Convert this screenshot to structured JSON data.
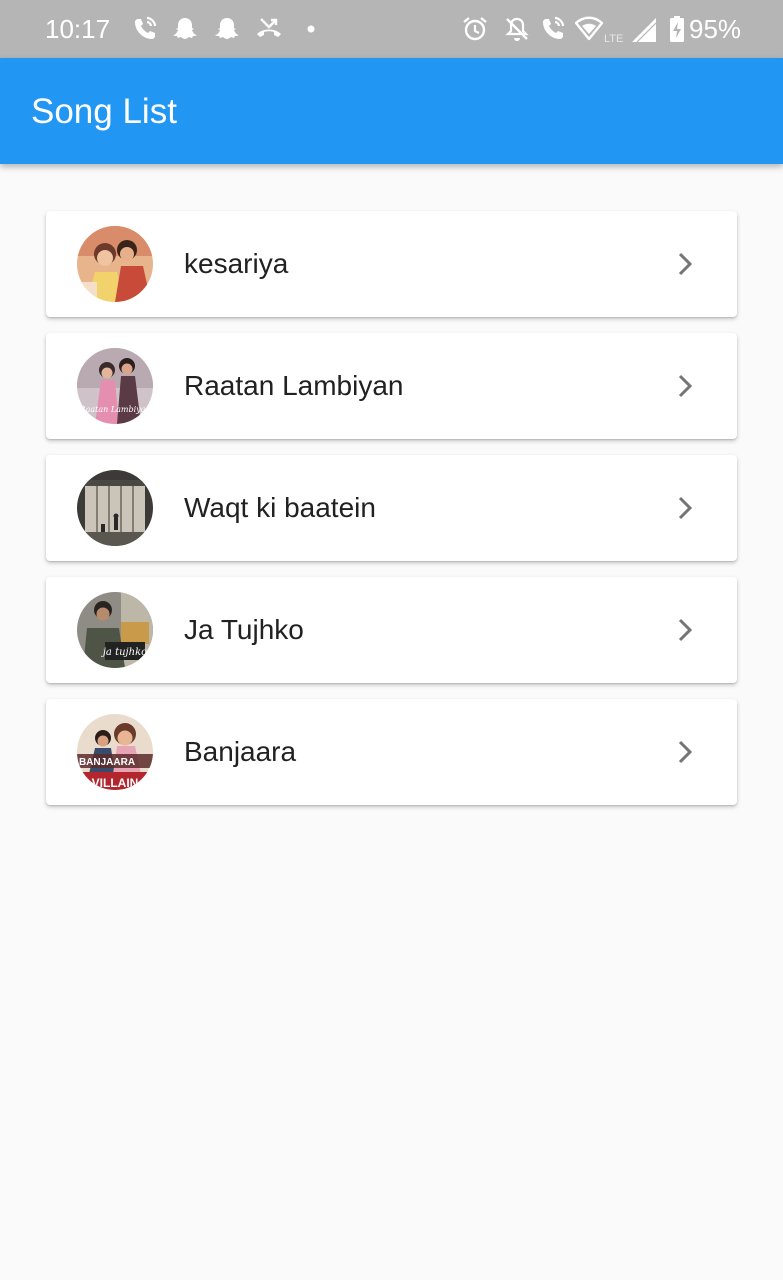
{
  "status_bar": {
    "time": "10:17",
    "battery_text": "95%",
    "icons": [
      "wifi-call-icon",
      "snapchat-icon",
      "snapchat-icon",
      "missed-call-icon",
      "dot-icon",
      "alarm-icon",
      "notifications-off-icon",
      "wifi-call-icon",
      "wifi-icon",
      "lte-signal-icon",
      "battery-charging-icon"
    ],
    "lte_label": "LTE"
  },
  "app_bar": {
    "title": "Song List",
    "color": "#2196f3"
  },
  "songs": [
    {
      "title": "kesariya",
      "icon": "chevron-right-icon"
    },
    {
      "title": "Raatan Lambiyan",
      "icon": "chevron-right-icon"
    },
    {
      "title": "Waqt ki baatein",
      "icon": "chevron-right-icon"
    },
    {
      "title": "Ja Tujhko",
      "icon": "chevron-right-icon"
    },
    {
      "title": "Banjaara",
      "icon": "chevron-right-icon"
    }
  ],
  "thumb_captions": [
    "Raatan Lambiyan",
    "ja tujhko",
    "BANJAARA",
    "VILLAIN"
  ],
  "colors": {
    "status_bar": "#b5b5b5",
    "background": "#fafafa",
    "card": "#ffffff",
    "text": "#212121",
    "chevron": "#757575"
  }
}
